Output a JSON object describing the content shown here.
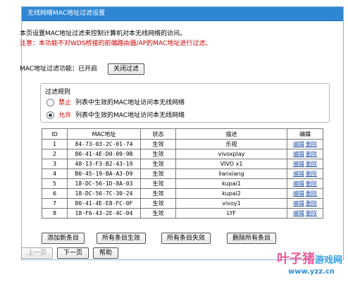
{
  "window": {
    "title": "无线网络MAC地址过滤设置"
  },
  "description": {
    "line1": "本页设置MAC地址过滤来控制计算机对本无线网络的访问。",
    "line2": "注意：本功能不对WDS桥接的前端路由器/AP的MAC地址进行过滤。"
  },
  "filter_status": {
    "label": "MAC地址过滤功能：已开启",
    "toggle_button": "关闭过滤"
  },
  "rules": {
    "legend": "过滤规则",
    "option_deny": {
      "keyword": "禁止",
      "text": "列表中生效的MAC地址访问本无线网络",
      "selected": false
    },
    "option_allow": {
      "keyword": "允许",
      "text": "列表中生效的MAC地址访问本无线网络",
      "selected": true
    }
  },
  "table": {
    "headers": [
      "ID",
      "MAC地址",
      "状态",
      "描述",
      "编辑"
    ],
    "edit_label": "编辑",
    "delete_label": "删除",
    "rows": [
      {
        "id": "1",
        "mac": "84-73-03-2C-01-74",
        "status": "生效",
        "desc": "乐视"
      },
      {
        "id": "2",
        "mac": "80-41-4E-D0-09-9B",
        "status": "生效",
        "desc": "vivoxplay"
      },
      {
        "id": "3",
        "mac": "48-13-F3-B2-43-19",
        "status": "生效",
        "desc": "VIVO x1"
      },
      {
        "id": "4",
        "mac": "B0-45-19-BA-A3-D9",
        "status": "生效",
        "desc": "lianxiang"
      },
      {
        "id": "5",
        "mac": "18-DC-56-1D-8A-03",
        "status": "生效",
        "desc": "kupai1"
      },
      {
        "id": "6",
        "mac": "18-DC-56-7C-30-24",
        "status": "生效",
        "desc": "kupai2"
      },
      {
        "id": "7",
        "mac": "80-41-4E-E8-FC-0F",
        "status": "生效",
        "desc": "vivoy1"
      },
      {
        "id": "8",
        "mac": "18-F6-43-2E-4C-04",
        "status": "生效",
        "desc": "LYF"
      }
    ]
  },
  "actions": {
    "add": "添加新条目",
    "enable_all": "所有条目生效",
    "disable_all": "所有条目失效",
    "delete_all": "删除所有条目"
  },
  "nav": {
    "prev": "上一页",
    "next": "下一页",
    "help": "帮助"
  },
  "watermark": {
    "brand": "叶子猪",
    "brand_sub": "游戏网",
    "url": "www.yzz.cn"
  },
  "colors": {
    "titlebar": "#2f86d3",
    "warning": "#cc0000",
    "link": "#2255aa"
  }
}
